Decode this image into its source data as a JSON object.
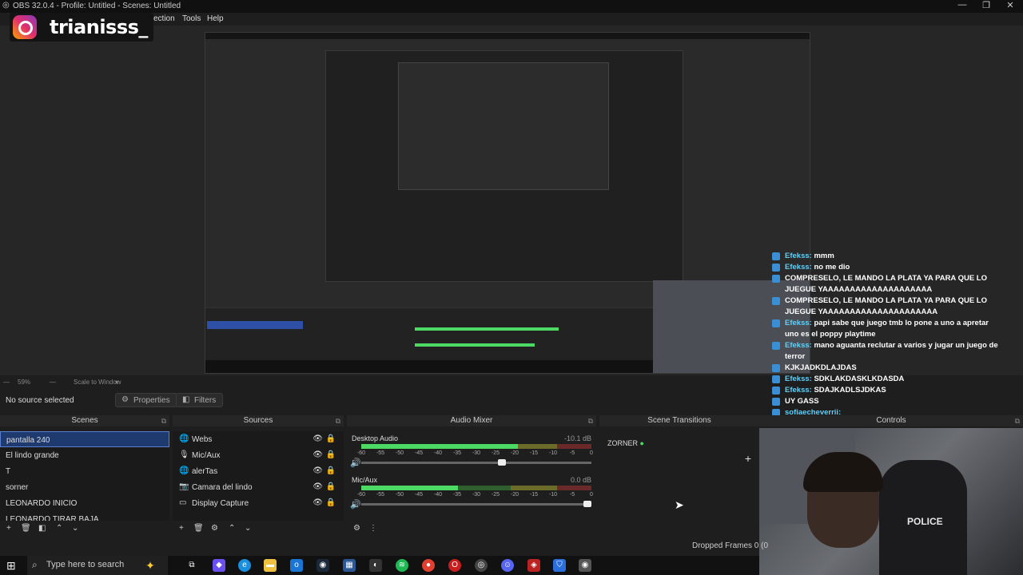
{
  "window": {
    "title": "OBS 32.0.4 - Profile: Untitled - Scenes: Untitled"
  },
  "menu": {
    "items": [
      "ection",
      "Tools",
      "Help"
    ]
  },
  "overlay": {
    "instagram_handle": "trianisss_"
  },
  "chat": [
    {
      "user": "Efekss:",
      "text": "mmm"
    },
    {
      "user": "Efekss:",
      "text": "no me dio"
    },
    {
      "user": "",
      "text": "COMPRESELO, LE MANDO LA PLATA YA PARA QUE LO JUEGUE YAAAAAAAAAAAAAAAAAAAA"
    },
    {
      "user": "",
      "text": "COMPRESELO, LE MANDO LA PLATA YA PARA QUE LO JUEGUE YAAAAAAAAAAAAAAAAAAAAA"
    },
    {
      "user": "Efekss:",
      "text": "papi sabe que juego tmb lo pone a uno a apretar uno es el poppy playtime"
    },
    {
      "user": "Efekss:",
      "text": "mano aguanta reclutar a varios y jugar un juego de terror"
    },
    {
      "user": "",
      "text": "KJKJADKDLAJDAS"
    },
    {
      "user": "Efekss:",
      "text": "SDKLAKDASKLKDASDA"
    },
    {
      "user": "Efekss:",
      "text": "SDAJKADLSJDKAS"
    },
    {
      "user": "",
      "text": "UY GASS"
    },
    {
      "user": "sofiaecheverrii:",
      "text": ""
    }
  ],
  "webcam": {
    "chair_text": "POLICE"
  },
  "status": {
    "zoom": "59%",
    "scale": "Scale to Window",
    "no_source": "No source selected",
    "dropped_frames": "Dropped Frames 0 (0"
  },
  "toolbar": {
    "properties": "Properties",
    "filters": "Filters"
  },
  "docks": {
    "scenes": {
      "title": "Scenes",
      "items": [
        "pantalla 240",
        "El lindo grande",
        "T",
        "sorner",
        "LEONARDO INICIO",
        "LEONARDO TIRAR BAJA"
      ],
      "selected": 0
    },
    "sources": {
      "title": "Sources",
      "items": [
        {
          "icon": "globe-icon",
          "label": "Webs"
        },
        {
          "icon": "mic-icon",
          "label": "Mic/Aux"
        },
        {
          "icon": "globe-icon",
          "label": "alerTas"
        },
        {
          "icon": "camera-icon",
          "label": "Camara del lindo"
        },
        {
          "icon": "monitor-icon",
          "label": "Display Capture"
        }
      ]
    },
    "mixer": {
      "title": "Audio Mixer",
      "channels": [
        {
          "name": "Desktop Audio",
          "db": "-10.1 dB",
          "level": 0.68,
          "volume": 0.63
        },
        {
          "name": "Mic/Aux",
          "db": "0.0 dB",
          "level": 0.42,
          "volume": 1.0
        }
      ],
      "scale": [
        "-60",
        "-55",
        "-50",
        "-45",
        "-40",
        "-35",
        "-30",
        "-25",
        "-20",
        "-15",
        "-10",
        "-5",
        "0"
      ]
    },
    "transitions": {
      "title": "Scene Transitions",
      "current": "ZORNER"
    },
    "controls": {
      "title": "Controls"
    }
  },
  "taskbar": {
    "search_placeholder": "Type here to search"
  }
}
